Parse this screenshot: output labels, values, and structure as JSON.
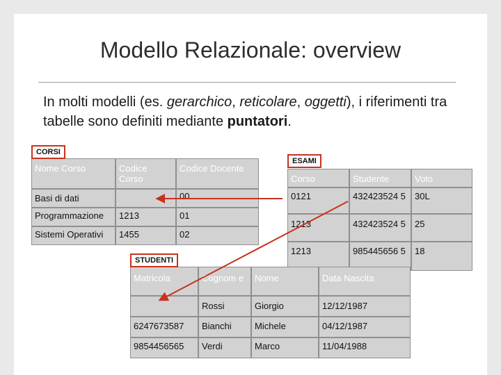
{
  "title": "Modello Relazionale: overview",
  "intro": {
    "prefix": "In molti modelli (es. ",
    "ex1": "gerarchico",
    "sep1": ", ",
    "ex2": "reticolare",
    "sep2": ", ",
    "ex3": "oggetti",
    "suffix": "), i riferimenti tra tabelle sono definiti mediante ",
    "bold": "puntatori",
    "end": "."
  },
  "corsi": {
    "tag": "CORSI",
    "headers": [
      "Nome Corso",
      "Codice Corso",
      "Codice Docente"
    ],
    "rows": [
      [
        "Basi di dati",
        "",
        "00"
      ],
      [
        "Programmazione",
        "1213",
        "01"
      ],
      [
        "Sistemi Operativi",
        "1455",
        "02"
      ]
    ]
  },
  "esami": {
    "tag": "ESAMI",
    "headers": [
      "Corso",
      "Studente",
      "Voto"
    ],
    "rows": [
      [
        "0121",
        "432423524 5",
        "30L"
      ],
      [
        "1213",
        "432423524 5",
        "25"
      ],
      [
        "1213",
        "985445656 5",
        "18"
      ]
    ]
  },
  "studenti": {
    "tag": "STUDENTI",
    "headers": [
      "Matricola",
      "Cognom e",
      "Nome",
      "Data Nascita"
    ],
    "rows": [
      [
        "",
        "Rossi",
        "Giorgio",
        "12/12/1987"
      ],
      [
        "6247673587",
        "Bianchi",
        "Michele",
        "04/12/1987"
      ],
      [
        "9854456565",
        "Verdi",
        "Marco",
        "11/04/1988"
      ]
    ]
  },
  "colors": {
    "accent": "#c8311d",
    "header_cell": "#d2d2d2",
    "grid": "#8f8f8f"
  }
}
